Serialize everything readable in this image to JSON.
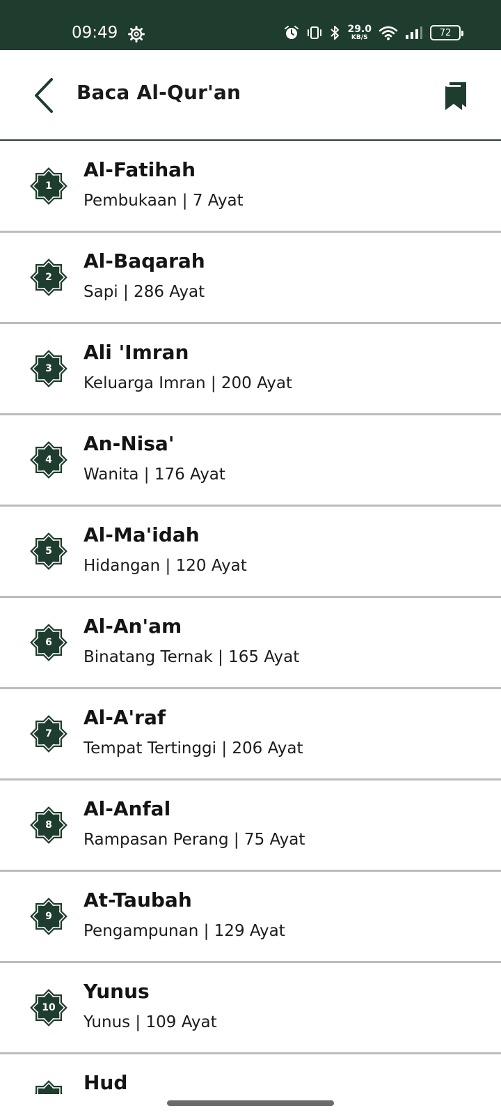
{
  "status_bar": {
    "time": "09:49",
    "net_speed_value": "29.0",
    "net_speed_unit": "KB/S",
    "battery_level": "72",
    "icons": [
      "gear-icon",
      "alarm-icon",
      "vibrate-icon",
      "bluetooth-icon",
      "wifi-icon",
      "signal-icon",
      "battery-icon"
    ]
  },
  "app_bar": {
    "title": "Baca Al-Qur'an",
    "back_icon": "chevron-left-icon",
    "bookmark_icon": "bookmark-icon"
  },
  "colors": {
    "primary": "#1f3d2e",
    "divider": "#b9bdbb"
  },
  "surahs": [
    {
      "number": "1",
      "name": "Al-Fatihah",
      "info": "Pembukaan | 7 Ayat"
    },
    {
      "number": "2",
      "name": "Al-Baqarah",
      "info": "Sapi | 286 Ayat"
    },
    {
      "number": "3",
      "name": "Ali 'Imran",
      "info": "Keluarga Imran | 200 Ayat"
    },
    {
      "number": "4",
      "name": "An-Nisa'",
      "info": "Wanita | 176 Ayat"
    },
    {
      "number": "5",
      "name": "Al-Ma'idah",
      "info": "Hidangan | 120 Ayat"
    },
    {
      "number": "6",
      "name": "Al-An'am",
      "info": "Binatang Ternak | 165 Ayat"
    },
    {
      "number": "7",
      "name": "Al-A'raf",
      "info": "Tempat Tertinggi | 206 Ayat"
    },
    {
      "number": "8",
      "name": "Al-Anfal",
      "info": "Rampasan Perang | 75 Ayat"
    },
    {
      "number": "9",
      "name": "At-Taubah",
      "info": "Pengampunan | 129 Ayat"
    },
    {
      "number": "10",
      "name": "Yunus",
      "info": "Yunus | 109 Ayat"
    },
    {
      "number": "",
      "name": "Hud",
      "info": ""
    }
  ]
}
